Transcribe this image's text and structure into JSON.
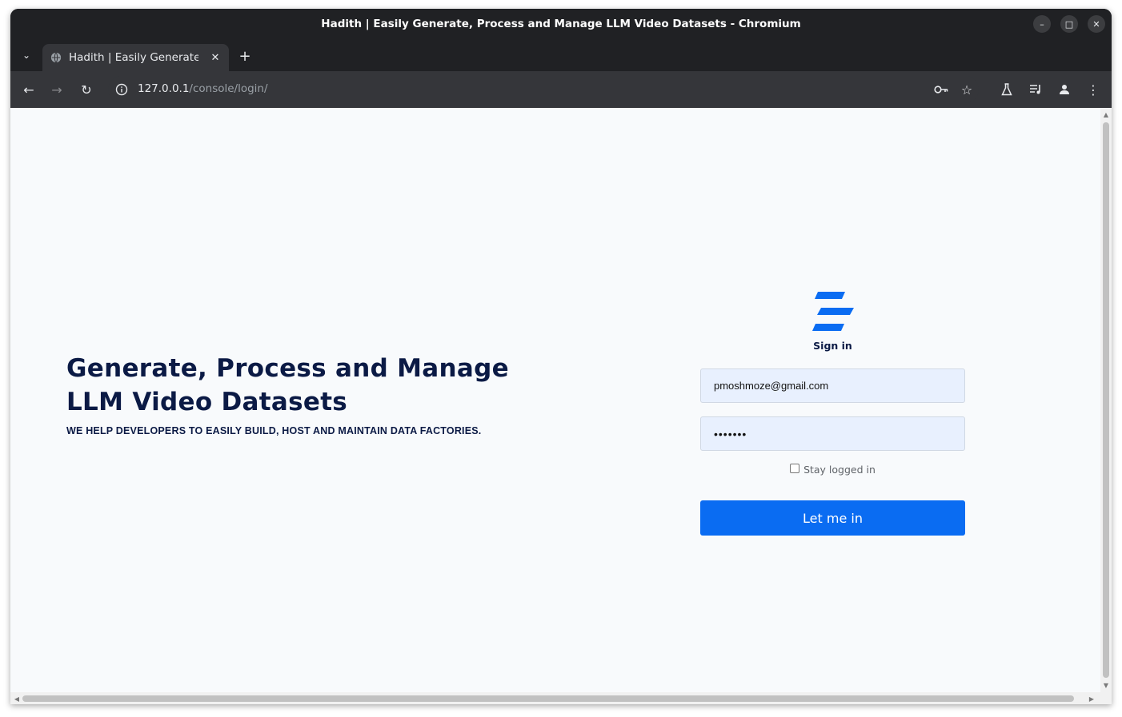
{
  "window": {
    "title": "Hadith | Easily Generate, Process and Manage LLM Video Datasets - Chromium"
  },
  "tab": {
    "title": "Hadith | Easily Generate,"
  },
  "address_bar": {
    "url_host": "127.0.0.1",
    "url_path": "/console/login/"
  },
  "hero": {
    "title": "Generate, Process and Manage LLM Video Datasets",
    "subtitle": "WE HELP DEVELOPERS TO EASILY BUILD, HOST AND MAINTAIN DATA FACTORIES."
  },
  "login": {
    "heading": "Sign in",
    "email_value": "pmoshmoze@gmail.com",
    "password_value": "•••••••",
    "remember_label": "Stay logged in",
    "remember_checked": false,
    "submit_label": "Let me in"
  },
  "colors": {
    "brand_blue": "#0a6cf2",
    "heading_navy": "#0b1a45",
    "page_background": "#f8fafc",
    "input_background": "#e8f0fe"
  },
  "icons": [
    "tab-list-icon",
    "globe-icon",
    "close-icon",
    "plus-icon",
    "back-icon",
    "forward-icon",
    "reload-icon",
    "info-icon",
    "key-icon",
    "star-icon",
    "flask-icon",
    "media-icon",
    "profile-icon",
    "menu-icon",
    "minimize-icon",
    "maximize-icon"
  ]
}
